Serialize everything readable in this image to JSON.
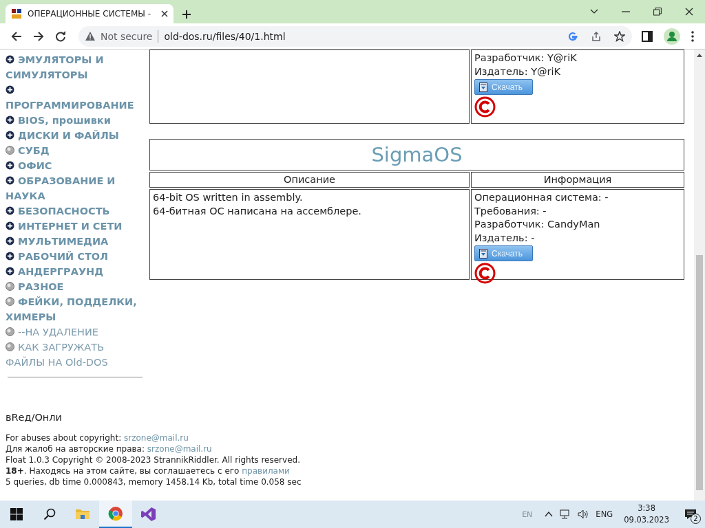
{
  "browser": {
    "tab_title": "ОПЕРАЦИОННЫЕ СИСТЕМЫ -",
    "security_label": "Not secure",
    "url": "old-dos.ru/files/40/1.html"
  },
  "sidebar": {
    "items": [
      {
        "label": "ЭМУЛЯТОРЫ И СИМУЛЯТОРЫ",
        "kind": "plus",
        "bold": true
      },
      {
        "label": "ПРОГРАММИРОВАНИЕ",
        "kind": "plus",
        "bold": true
      },
      {
        "label": "BIOS, прошивки",
        "kind": "plus",
        "bold": true
      },
      {
        "label": "ДИСКИ И ФАЙЛЫ",
        "kind": "plus",
        "bold": true
      },
      {
        "label": "СУБД",
        "kind": "ball",
        "bold": true
      },
      {
        "label": "ОФИС",
        "kind": "plus",
        "bold": true
      },
      {
        "label": "ОБРАЗОВАНИЕ И НАУКА",
        "kind": "plus",
        "bold": true
      },
      {
        "label": "БЕЗОПАСНОСТЬ",
        "kind": "plus",
        "bold": true
      },
      {
        "label": "ИНТЕРНЕТ И СЕТИ",
        "kind": "plus",
        "bold": true
      },
      {
        "label": "МУЛЬТИМЕДИА",
        "kind": "plus",
        "bold": true
      },
      {
        "label": "РАБОЧИЙ СТОЛ",
        "kind": "plus",
        "bold": true
      },
      {
        "label": "АНДЕРГРАУНД",
        "kind": "plus",
        "bold": true
      },
      {
        "label": "РАЗНОЕ",
        "kind": "ball",
        "bold": true
      },
      {
        "label": "ФЕЙКИ, ПОДДЕЛКИ, ХИМЕРЫ",
        "kind": "ball",
        "bold": true
      },
      {
        "label": "--НА УДАЛЕНИЕ",
        "kind": "ball",
        "bold": false
      },
      {
        "label": "КАК ЗАГРУЖАТЬ ФАЙЛЫ НА Old-DOS",
        "kind": "ball",
        "bold": false
      }
    ]
  },
  "entries": [
    {
      "info": [
        "Разработчик: Y@riK",
        "Издатель: Y@riK"
      ],
      "download": "Скачать"
    },
    {
      "title": "SigmaOS",
      "columns": [
        "Описание",
        "Информация"
      ],
      "description": [
        "64-bit OS written in assembly.",
        "64-битная ОС написана на ассемблере."
      ],
      "info": [
        "Операционная система: -",
        "Требования: -",
        "Разработчик: CandyMan",
        "Издатель: -"
      ],
      "download": "Скачать"
    }
  ],
  "footer": {
    "signature": "вRед/Онли",
    "lines": [
      {
        "text": "For abuses about copyright:",
        "link": "srzone@mail.ru"
      },
      {
        "text": "Для жалоб на авторские права:",
        "link": "srzone@mail.ru"
      },
      {
        "text": "Float 1.0.3 Copyright © 2008-2023 StrannikRiddler. All rights reserved."
      },
      {
        "text": "**18+**. Находясь на этом сайте, вы соглашаетесь с его",
        "link": "правилами"
      },
      {
        "text": "5 queries, db time 0.000843, memory 1458.14 Kb, total time 0.058 sec"
      }
    ]
  },
  "taskbar": {
    "apps": [
      {
        "kind": "folder",
        "active": false
      },
      {
        "kind": "browser",
        "active": true
      },
      {
        "kind": "ide",
        "active": false
      }
    ],
    "input_hint": "EN",
    "language": "ENG",
    "time": "3:38",
    "date": "09.03.2023",
    "notifications": "2"
  }
}
